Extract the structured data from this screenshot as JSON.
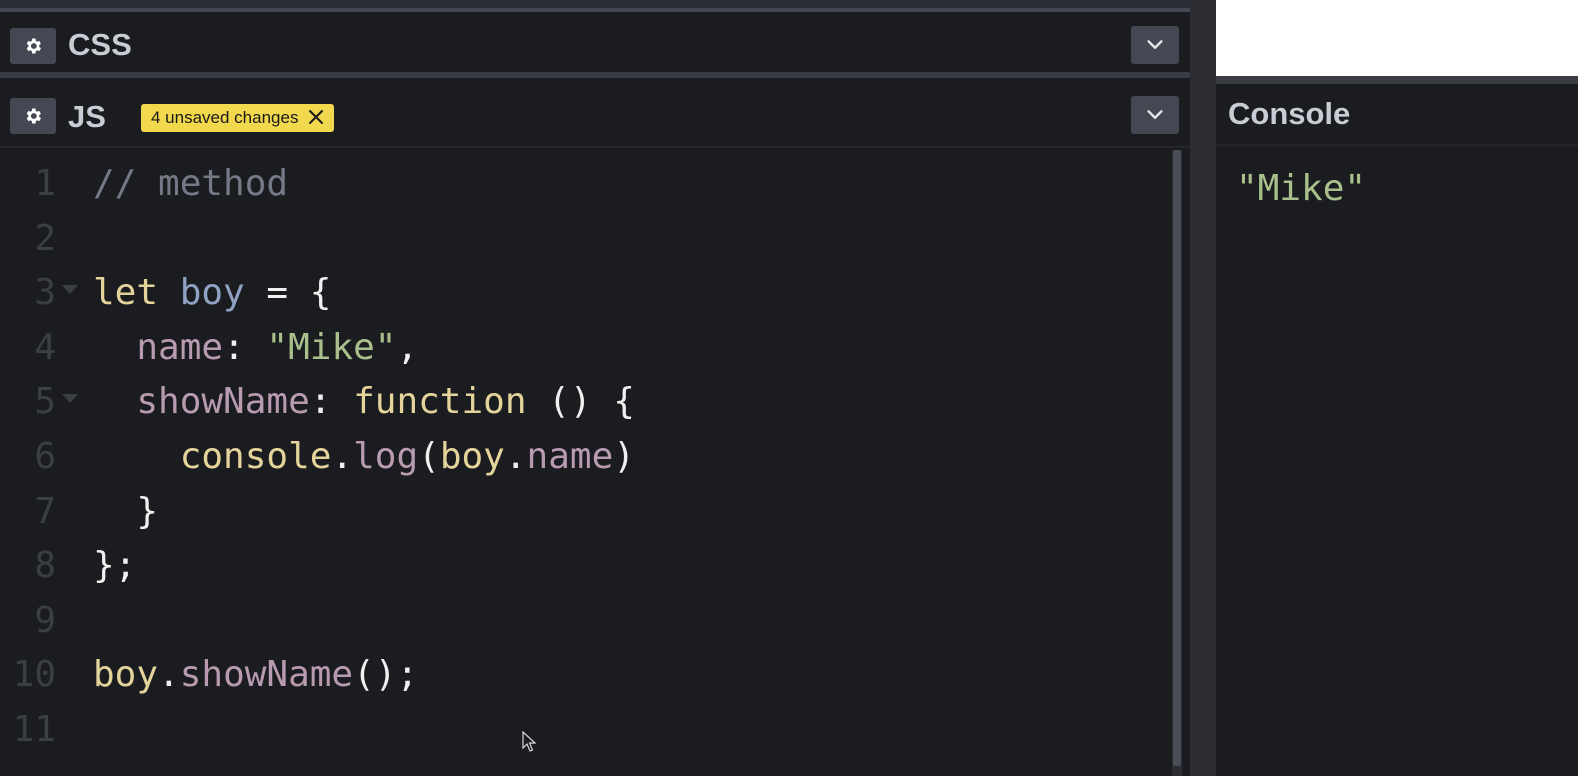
{
  "css_panel": {
    "title": "CSS"
  },
  "js_panel": {
    "title": "JS",
    "unsaved_badge": "4 unsaved changes"
  },
  "code": {
    "lines": [
      {
        "n": "1",
        "tokens": [
          {
            "t": "// method",
            "c": "tok-comment"
          }
        ]
      },
      {
        "n": "2",
        "tokens": []
      },
      {
        "n": "3",
        "fold": true,
        "tokens": [
          {
            "t": "let ",
            "c": "tok-kw"
          },
          {
            "t": "boy",
            "c": "tok-var"
          },
          {
            "t": " = {",
            "c": "tok-punc"
          }
        ]
      },
      {
        "n": "4",
        "tokens": [
          {
            "t": "  ",
            "c": "tok-punc"
          },
          {
            "t": "name",
            "c": "tok-prop"
          },
          {
            "t": ": ",
            "c": "tok-punc"
          },
          {
            "t": "\"Mike\"",
            "c": "tok-str"
          },
          {
            "t": ",",
            "c": "tok-punc"
          }
        ]
      },
      {
        "n": "5",
        "fold": true,
        "tokens": [
          {
            "t": "  ",
            "c": "tok-punc"
          },
          {
            "t": "showName",
            "c": "tok-prop"
          },
          {
            "t": ": ",
            "c": "tok-punc"
          },
          {
            "t": "function",
            "c": "tok-kw"
          },
          {
            "t": " () {",
            "c": "tok-punc"
          }
        ]
      },
      {
        "n": "6",
        "tokens": [
          {
            "t": "    ",
            "c": "tok-punc"
          },
          {
            "t": "console",
            "c": "tok-obj"
          },
          {
            "t": ".",
            "c": "tok-punc"
          },
          {
            "t": "log",
            "c": "tok-method"
          },
          {
            "t": "(",
            "c": "tok-punc"
          },
          {
            "t": "boy",
            "c": "tok-obj"
          },
          {
            "t": ".",
            "c": "tok-punc"
          },
          {
            "t": "name",
            "c": "tok-method"
          },
          {
            "t": ")",
            "c": "tok-punc"
          }
        ]
      },
      {
        "n": "7",
        "tokens": [
          {
            "t": "  }",
            "c": "tok-punc"
          }
        ]
      },
      {
        "n": "8",
        "tokens": [
          {
            "t": "};",
            "c": "tok-punc"
          }
        ]
      },
      {
        "n": "9",
        "tokens": []
      },
      {
        "n": "10",
        "tokens": [
          {
            "t": "boy",
            "c": "tok-obj"
          },
          {
            "t": ".",
            "c": "tok-punc"
          },
          {
            "t": "showName",
            "c": "tok-method"
          },
          {
            "t": "();",
            "c": "tok-punc"
          }
        ]
      },
      {
        "n": "11",
        "tokens": []
      }
    ]
  },
  "console": {
    "title": "Console",
    "output": "\"Mike\""
  },
  "icons": {
    "settings": "gear-icon",
    "collapse": "chevron-down-icon",
    "dismiss": "close-icon",
    "pointer": "mouse-pointer-icon"
  },
  "colors": {
    "badge": "#f2d84d",
    "string": "#a9c08c",
    "keyword": "#e4d49b",
    "property": "#b89bb0",
    "comment": "#747987"
  }
}
